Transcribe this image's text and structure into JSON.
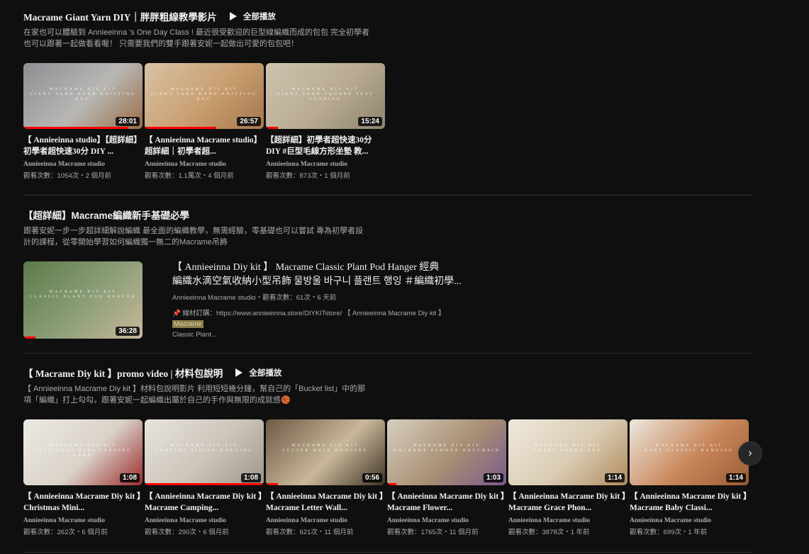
{
  "sections": [
    {
      "title": "Macrame Giant Yarn DIY｜胖胖粗線教學影片",
      "play_all": "全部播放",
      "desc_line1": "在家也可以體驗到 Annieeinna 's One Day Class ! 最近很受歡迎的巨型線編織而成的包包 完全初學者",
      "desc_line2": "也可以跟著一起做看看喔！ 只需要我們的雙手跟著安妮一起做出可愛的包包吧！",
      "videos": [
        {
          "title": "【 Annieeinna studio】【超詳細】初學者超快速30分 DIY ...",
          "channel": "Annieeinna Macrame studio",
          "meta": "觀看次數：1054次・2 個月前",
          "duration": "28:01",
          "watched": 0.88,
          "wm1": "MACRAME DIY KIT",
          "wm2": "GIANT YARN HAND KNITTING BAG",
          "colors": [
            "#8c8f93",
            "#b9b7b4",
            "#9a6d45"
          ]
        },
        {
          "title": "【 Annieeinna Macrame studio】超詳細｜初學者超...",
          "channel": "Annieeinna Macrame studio",
          "meta": "觀看次數：1.1萬次・4 個月前",
          "duration": "26:57",
          "watched": 0.6,
          "wm1": "MACRAME DIY KIT",
          "wm2": "GIANT YARN HAND KNITTING BAG",
          "colors": [
            "#d8c3a5",
            "#c89e70",
            "#a5774c"
          ]
        },
        {
          "title": "【超詳細】初學者超快速30分 DIY #巨型毛線方形坐墊 教...",
          "channel": "Annieeinna Macrame studio",
          "meta": "觀看次數：873次・1 個月前",
          "duration": "15:24",
          "watched": 0.1,
          "wm1": "MACRAME DIY KIT",
          "wm2": "GIANT YARN SQUARE SEAT CUSHION",
          "colors": [
            "#cfc4b0",
            "#b7aa90",
            "#8f8470"
          ]
        }
      ]
    },
    {
      "title": "【超詳細】Macrame編織新手基礎必學",
      "desc_line1": "跟著安妮一步一步超詳細解說編織 最全面的編織教學，無需經驗，零基礎也可以嘗試 專為初學者設",
      "desc_line2": "計的課程，從零開始學習如何編織獨一無二的Macrame吊飾",
      "video": {
        "title_line1": "【 Annieeinna Diy kit 】 Macrame Classic Plant Pod Hanger 經典",
        "title_line2": "編織水滴空氣收納小型吊飾 물방울 바구니 플랜트 행잉 ＃編織初學...",
        "meta": "Annieeinna Macrame studio・觀看次數：61次・6 天前",
        "desc_prefix": "📌 線材訂購：https://www.annieeinna.store/DIYKITstore/ 【 Annieeinna Macrame Diy kit 】",
        "desc_highlight": "Macrame",
        "desc_line2": "Classic Plant...",
        "duration": "36:28",
        "watched": 0.1,
        "wm1": "MACRAME DIY KIT",
        "wm2": "CLASSIC PLANT POD HANGER",
        "colors": [
          "#5c7a4a",
          "#8ea07a",
          "#c9b79a"
        ]
      }
    },
    {
      "title": "【 Macrame Diy kit 】promo video | 材料包說明",
      "play_all": "全部播放",
      "desc_line1": "【 Annieeinna Macrame Diy kit 】材料包說明影片 利用短短幾分鐘，幫自己的「Bucket list」中的那",
      "desc_line2": "項「編織」打上勾勾，跟著安妮一起編織出屬於自己的手作與無限的成就感🏀",
      "videos": [
        {
          "title": "【 Annieeinna Macrame Diy kit 】Christmas Mini...",
          "channel": "Annieeinna Macrame studio",
          "meta": "觀看次數：262次・6 個月前",
          "duration": "1:08",
          "watched": 0.0,
          "wm1": "MACRAME DIY KIT",
          "wm2": "CHRISTMAS MINI HANGING CARD",
          "colors": [
            "#ece9e4",
            "#d9d2c8",
            "#9c2b2b"
          ]
        },
        {
          "title": "【 Annieeinna Macrame Diy kit 】Macrame Camping...",
          "channel": "Annieeinna Macrame studio",
          "meta": "觀看次數：290次・6 個月前",
          "duration": "1:08",
          "watched": 1.0,
          "wm1": "MACRAME DIY KIT",
          "wm2": "CAMPING TISSUE HANGING",
          "colors": [
            "#e8e4de",
            "#cbc4b9",
            "#9e968a"
          ]
        },
        {
          "title": "【 Annieeinna Macrame Diy kit 】Macrame Letter Wall...",
          "channel": "Annieeinna Macrame studio",
          "meta": "觀看次數：621次・11 個月前",
          "duration": "0:56",
          "watched": 0.1,
          "wm1": "MACRAME DIY KIT",
          "wm2": "LETTER WALL HANGING",
          "colors": [
            "#6e5a45",
            "#c9b89b",
            "#3f3326"
          ]
        },
        {
          "title": "【 Annieeinna Macrame Diy kit 】Macrame Flower...",
          "channel": "Annieeinna Macrame studio",
          "meta": "觀看次數：1765次・11 個月前",
          "duration": "1:03",
          "watched": 0.08,
          "wm1": "MACRAME DIY KIT",
          "wm2": "MACRAME FLOWER KEYCHAIN",
          "colors": [
            "#d7cfc0",
            "#a88f73",
            "#7a5a8c"
          ]
        },
        {
          "title": "【 Annieeinna Macrame Diy kit 】Macrame Grace Phon...",
          "channel": "Annieeinna Macrame studio",
          "meta": "觀看次數：3878次・1 年前",
          "duration": "1:14",
          "watched": 0.0,
          "wm1": "MACRAME DIY KIT",
          "wm2": "GRACE PHONE BAG",
          "colors": [
            "#efe8dc",
            "#d9cbb3",
            "#b08a5c"
          ]
        },
        {
          "title": "【 Annieeinna Macrame Diy kit 】Macrame Baby Classi...",
          "channel": "Annieeinna Macrame studio",
          "meta": "觀看次數：699次・1 年前",
          "duration": "1:14",
          "watched": 0.0,
          "wm1": "MACRAME DIY KIT",
          "wm2": "BABY CLASSIC HANGING",
          "colors": [
            "#ede7de",
            "#c8875a",
            "#9a5a34"
          ]
        }
      ]
    }
  ],
  "next_button_label": "›"
}
